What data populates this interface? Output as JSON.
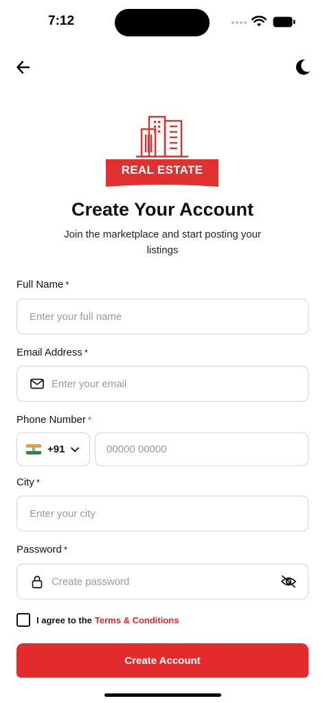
{
  "status_bar": {
    "time": "7:12",
    "icons": [
      "signal-icon",
      "wifi-icon",
      "battery-icon"
    ]
  },
  "header": {
    "back_icon": "arrow-left-icon",
    "theme_icon": "moon-icon"
  },
  "logo": {
    "text": "REAL ESTATE",
    "icon": "building-icon",
    "color": "#e0302f"
  },
  "title": "Create Your Account",
  "subtitle": "Join the marketplace and start posting your listings",
  "form": {
    "full_name": {
      "label": "Full Name",
      "required": "*",
      "placeholder": "Enter your full name"
    },
    "email": {
      "label": "Email Address",
      "required": "*",
      "placeholder": "Enter your email",
      "icon": "mail-icon"
    },
    "phone": {
      "label": "Phone Number",
      "required": "*",
      "country_code": "+91",
      "country_flag": "india-flag-icon",
      "placeholder": "00000 00000"
    },
    "city": {
      "label": "City",
      "required": "*",
      "placeholder": "Enter your city"
    },
    "password": {
      "label": "Password",
      "required": "*",
      "placeholder": "Create password",
      "icon": "lock-icon",
      "toggle_icon": "eye-off-icon"
    },
    "agree": {
      "text": "I agree to the",
      "link": "Terms & Conditions",
      "checked": false
    }
  },
  "submit_label": "Create Account",
  "colors": {
    "accent": "#e32a2c",
    "border": "#d4d4d4",
    "placeholder": "#9a9a9a"
  }
}
